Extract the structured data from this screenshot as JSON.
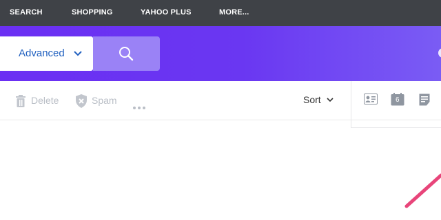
{
  "topnav": {
    "links": [
      "SEARCH",
      "SHOPPING",
      "YAHOO PLUS",
      "MORE..."
    ]
  },
  "search_bar": {
    "advanced_label": "Advanced"
  },
  "toolbar": {
    "delete_label": "Delete",
    "spam_label": "Spam",
    "sort_label": "Sort"
  },
  "right_panel": {
    "calendar_day": "6"
  },
  "colors": {
    "topnav_bg": "#3f4247",
    "banner_start": "#6b2ff3",
    "banner_end": "#7a5cf4",
    "search_button": "#9a82f6",
    "arrow": "#e8457a"
  },
  "icons": [
    "chevron-down-icon",
    "search-icon",
    "trash-icon",
    "shield-x-icon",
    "more-dots-icon",
    "contacts-card-icon",
    "calendar-icon",
    "notepad-icon",
    "annotation-arrow"
  ]
}
